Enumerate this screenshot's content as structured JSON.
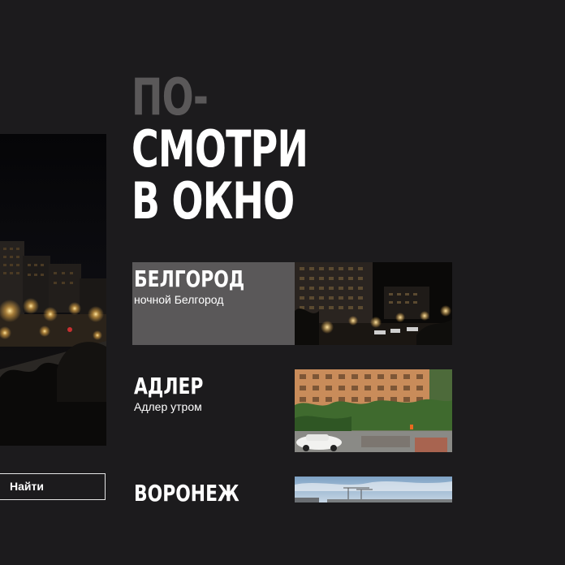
{
  "headline": {
    "line1": "ПО-",
    "line2": "СМОТРИ",
    "line3": "В ОКНО"
  },
  "search": {
    "button_label": "Найти"
  },
  "cities": [
    {
      "name": "БЕЛГОРОД",
      "subtitle": "ночной Белгород",
      "active": true,
      "thumb": "night-city-photo"
    },
    {
      "name": "АДЛЕР",
      "subtitle": "Адлер утром",
      "active": false,
      "thumb": "morning-courtyard-photo"
    },
    {
      "name": "ВОРОНЕЖ",
      "subtitle": "",
      "active": false,
      "thumb": "day-skyline-photo"
    }
  ],
  "colors": {
    "background": "#1c1b1d",
    "headline_muted": "#5a5859",
    "headline_main": "#ffffff",
    "active_card": "#5a5859"
  }
}
